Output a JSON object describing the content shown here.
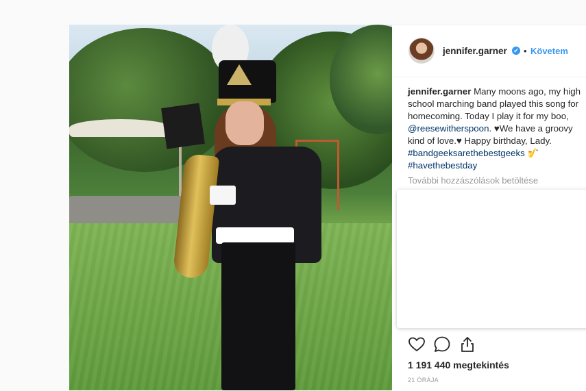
{
  "post": {
    "username": "jennifer.garner",
    "follow_label": "Követem",
    "separator": "•",
    "verified_icon": "✔",
    "caption_lines": [
      {
        "user": "jennifer.garner",
        "text": " Many moons ago, my high"
      },
      {
        "text": "school marching band played this song for"
      },
      {
        "text": "homecoming. Today I play it for my boo,"
      },
      {
        "mention": "@reesewitherspoon",
        "text": ". ♥We have a groovy"
      },
      {
        "text": "kind of love.♥ Happy birthday, Lady."
      },
      {
        "hashtag": "#bandgeeksarethebestgeeks",
        "text": " 🎷"
      },
      {
        "hashtag": "#havethebestday"
      }
    ],
    "load_more": "További hozzászólások betöltése",
    "views": "1 191 440 megtekintés",
    "time": "21 ÓRÁJA"
  },
  "icons": {
    "like": "heart-icon",
    "comment": "comment-icon",
    "share": "share-icon"
  },
  "colors": {
    "link": "#003569",
    "accent": "#3897f0",
    "muted": "#999999"
  }
}
